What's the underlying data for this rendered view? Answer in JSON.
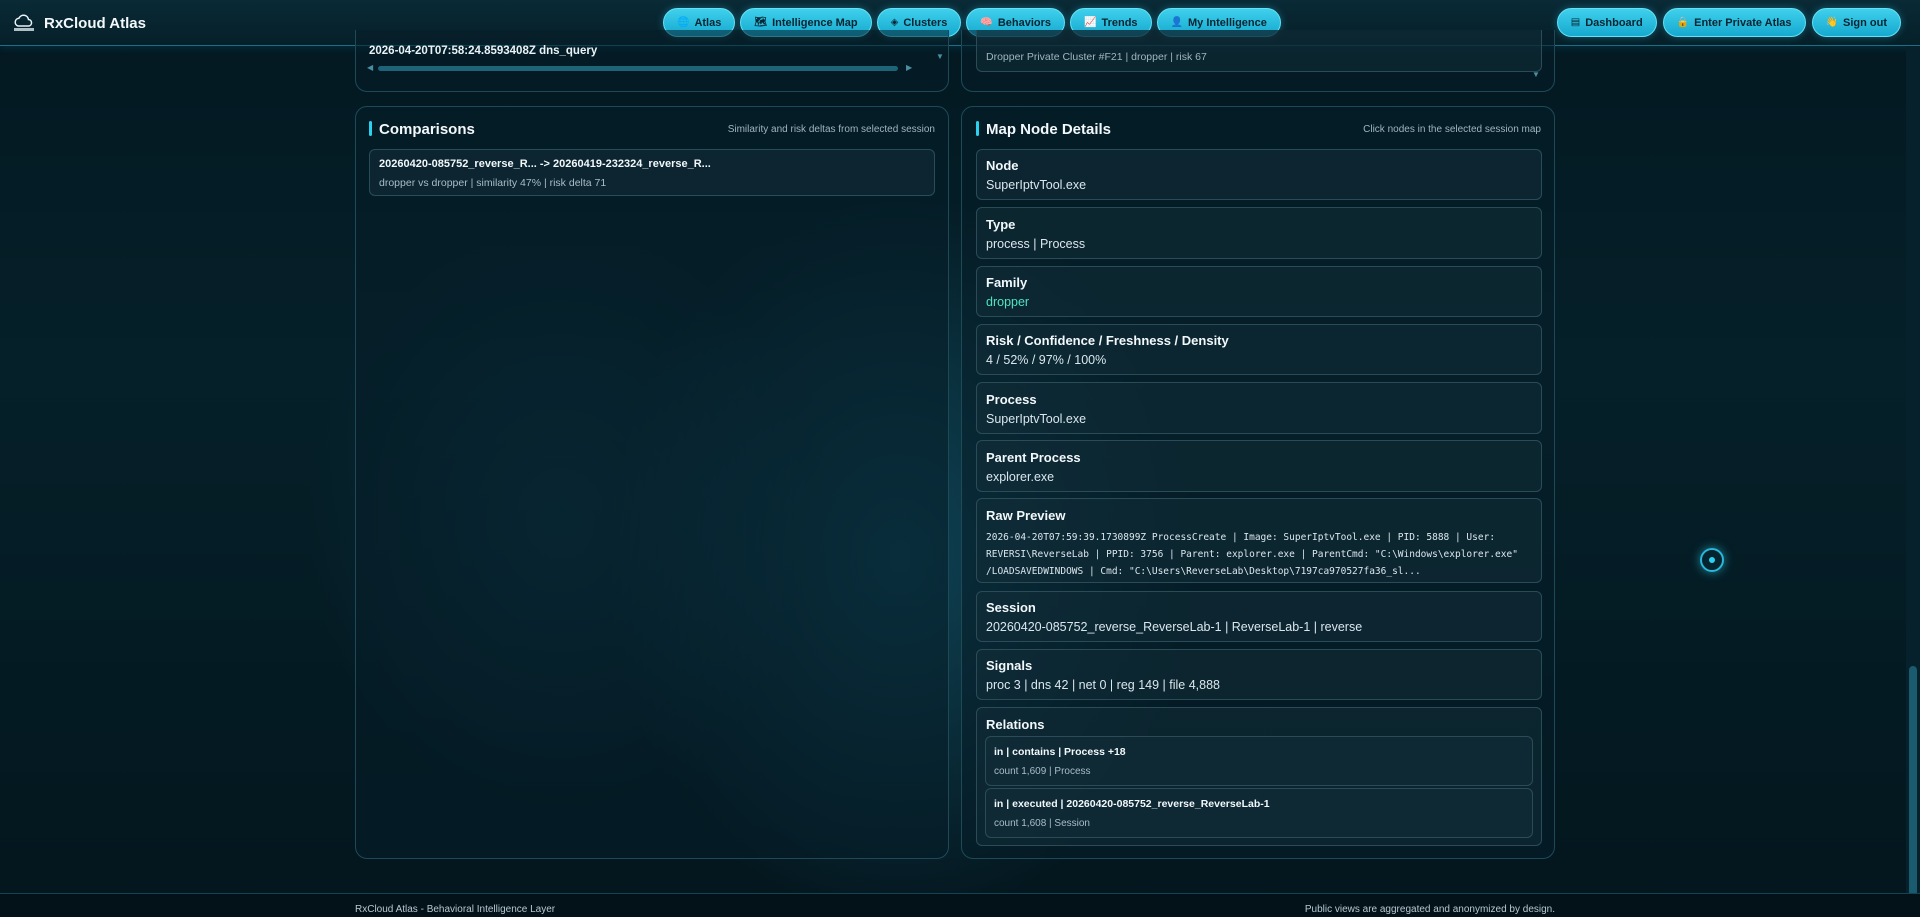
{
  "app": {
    "title": "RxCloud Atlas"
  },
  "nav": {
    "items": [
      {
        "label": "Atlas",
        "icon": "globe-icon"
      },
      {
        "label": "Intelligence Map",
        "icon": "map-icon"
      },
      {
        "label": "Clusters",
        "icon": "clusters-icon"
      },
      {
        "label": "Behaviors",
        "icon": "brain-icon"
      },
      {
        "label": "Trends",
        "icon": "trend-icon"
      },
      {
        "label": "My Intelligence",
        "icon": "user-icon"
      }
    ],
    "right": [
      {
        "label": "Dashboard",
        "icon": "dashboard-icon"
      },
      {
        "label": "Enter Private Atlas",
        "icon": "lock-icon"
      },
      {
        "label": "Sign out",
        "icon": "wave-icon"
      }
    ]
  },
  "top_fragments": {
    "left_text": "2026-04-20T07:58:24.8593408Z dns_query",
    "right_text": "Dropper Private Cluster #F21 | dropper | risk 67"
  },
  "comparisons": {
    "title": "Comparisons",
    "hint": "Similarity and risk deltas from selected session",
    "items": [
      {
        "title": "20260420-085752_reverse_R... -> 20260419-232324_reverse_R...",
        "detail": "dropper vs dropper | similarity 47% | risk delta 71"
      }
    ]
  },
  "details": {
    "title": "Map Node Details",
    "hint": "Click nodes in the selected session map",
    "node": {
      "label": "Node",
      "value": "SuperIptvTool.exe"
    },
    "type": {
      "label": "Type",
      "value": "process | Process"
    },
    "family": {
      "label": "Family",
      "value": "dropper"
    },
    "risk": {
      "label": "Risk / Confidence / Freshness / Density",
      "value": "4 / 52% / 97% / 100%"
    },
    "process": {
      "label": "Process",
      "value": "SuperIptvTool.exe"
    },
    "parent": {
      "label": "Parent Process",
      "value": "explorer.exe"
    },
    "raw": {
      "label": "Raw Preview",
      "lines": [
        "2026-04-20T07:59:39.1730899Z ProcessCreate | Image: SuperIptvTool.exe | PID: 5888 | User:",
        "REVERSI\\ReverseLab | PPID: 3756 | Parent: explorer.exe | ParentCmd: \"C:\\Windows\\explorer.exe\"",
        "/LOADSAVEDWINDOWS | Cmd: \"C:\\Users\\ReverseLab\\Desktop\\7197ca970527fa36_sl..."
      ]
    },
    "session": {
      "label": "Session",
      "value": "20260420-085752_reverse_ReverseLab-1 | ReverseLab-1 | reverse"
    },
    "signals": {
      "label": "Signals",
      "value": "proc 3 | dns 42 | net 0 | reg 149 | file 4,888"
    },
    "relations": {
      "label": "Relations",
      "items": [
        {
          "title": "in | contains | Process +18",
          "detail": "count 1,609 | Process"
        },
        {
          "title": "in | executed | 20260420-085752_reverse_ReverseLab-1",
          "detail": "count 1,608 | Session"
        }
      ]
    }
  },
  "footer": {
    "left": "RxCloud Atlas - Behavioral Intelligence Layer",
    "right": "Public views are aggregated and anonymized by design."
  },
  "colors": {
    "accent": "#2bd2f0",
    "family": "#4fe3c1",
    "background": "#041821"
  }
}
